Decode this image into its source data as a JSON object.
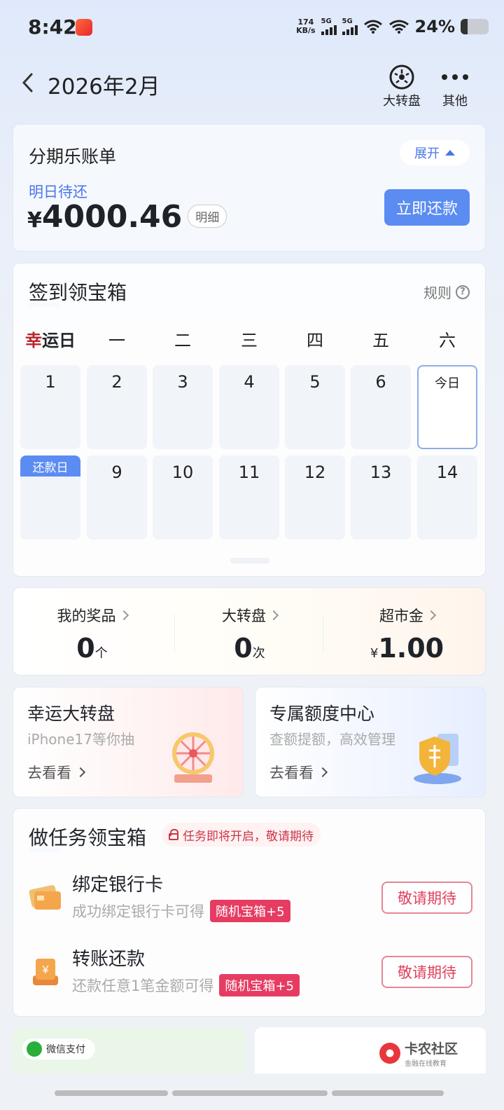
{
  "status": {
    "time": "8:42",
    "speed_value": "174",
    "speed_unit": "KB/s",
    "sim1": "5G",
    "sim2": "5G",
    "battery": "24%",
    "battery_level": 0.24
  },
  "header": {
    "title": "2026年2月",
    "wheel_label": "大转盘",
    "more_label": "其他"
  },
  "bill": {
    "title": "分期乐账单",
    "expand_label": "展开",
    "due_label": "明日待还",
    "currency": "¥",
    "amount": "4000.46",
    "detail_label": "明细",
    "pay_button": "立即还款"
  },
  "checkin": {
    "title": "签到领宝箱",
    "rules_label": "规则",
    "weekdays": [
      "幸运日",
      "一",
      "二",
      "三",
      "四",
      "五",
      "六"
    ],
    "week1": [
      "1",
      "2",
      "3",
      "4",
      "5",
      "6",
      "今日"
    ],
    "week2": [
      "",
      "9",
      "10",
      "11",
      "12",
      "13",
      "14"
    ],
    "repay_tag": "还款日"
  },
  "stats": [
    {
      "label": "我的奖品",
      "value": "0",
      "unit": "个"
    },
    {
      "label": "大转盘",
      "value": "0",
      "unit": "次"
    },
    {
      "label": "超市金",
      "prefix": "¥",
      "value": "1.00"
    }
  ],
  "promos": [
    {
      "title": "幸运大转盘",
      "subtitle": "iPhone17等你抽",
      "link": "去看看"
    },
    {
      "title": "专属额度中心",
      "subtitle": "查额提额，高效管理",
      "link": "去看看"
    }
  ],
  "tasks": {
    "title": "做任务领宝箱",
    "notice": "任务即将开启，敬请期待",
    "items": [
      {
        "title": "绑定银行卡",
        "desc": "成功绑定银行卡可得",
        "badge": "随机宝箱+5",
        "button": "敬请期待"
      },
      {
        "title": "转账还款",
        "desc": "还款任意1笔金额可得",
        "badge": "随机宝箱+5",
        "button": "敬请期待"
      }
    ]
  },
  "footer": {
    "wechat_pay": "微信支付",
    "watermark_title": "卡农社区",
    "watermark_sub": "金融在线教育"
  },
  "colors": {
    "accent": "#5b8cf2",
    "danger": "#e0405c",
    "badge": "#e63c62"
  }
}
